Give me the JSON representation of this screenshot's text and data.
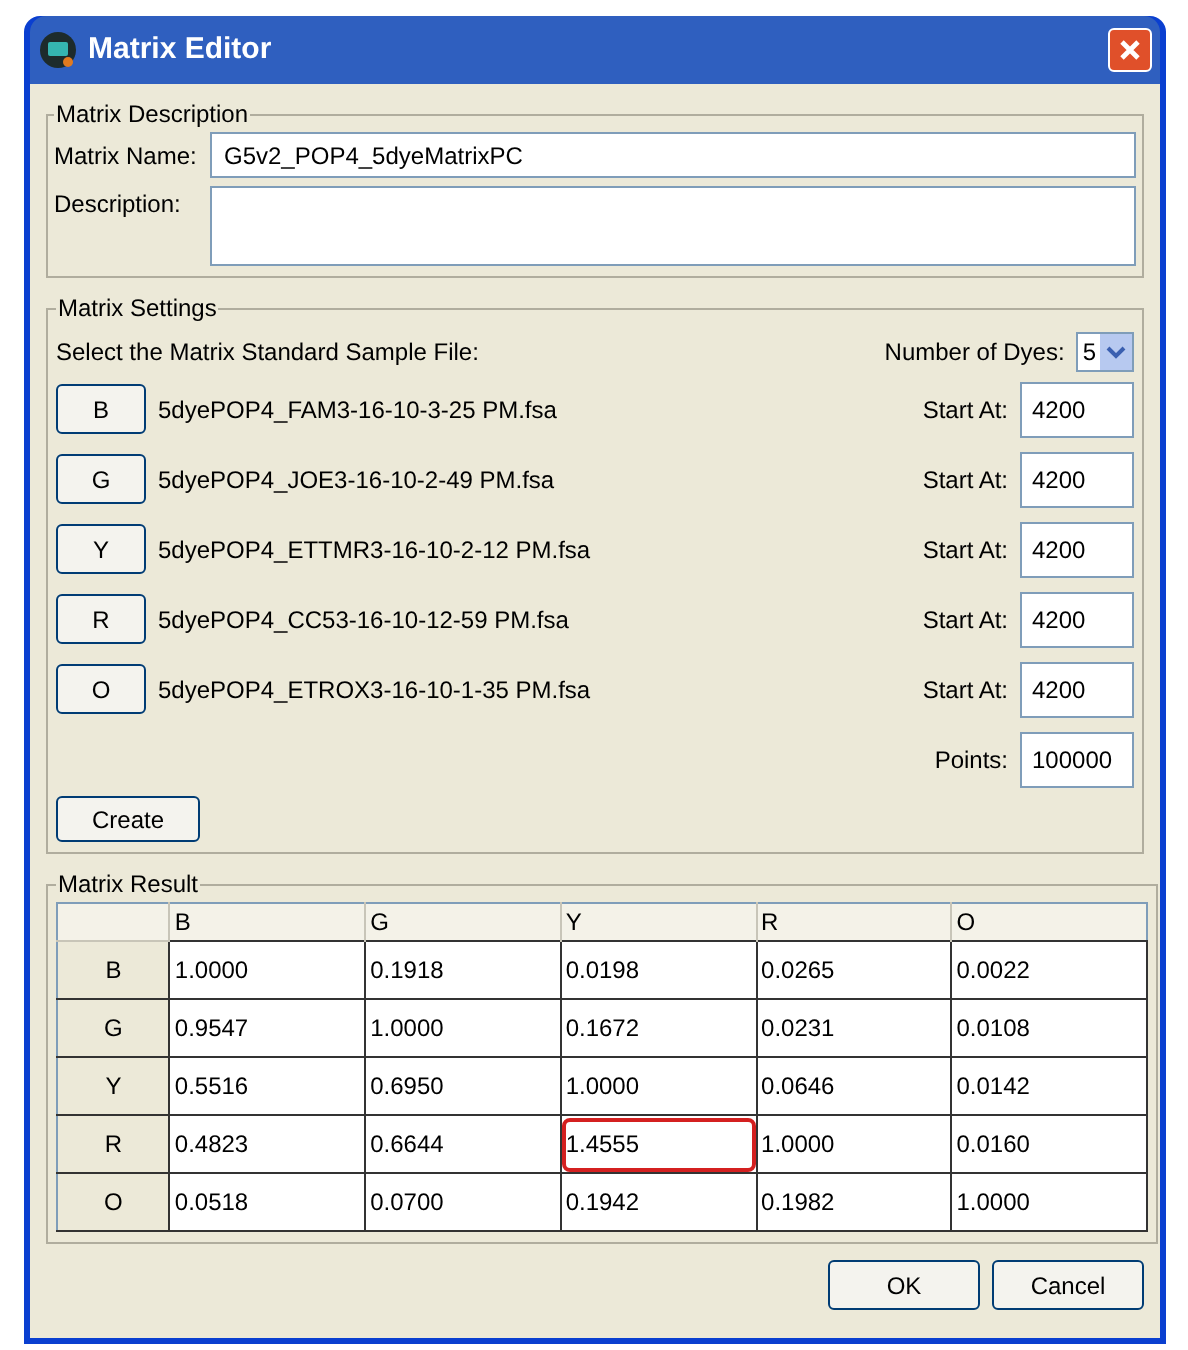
{
  "window": {
    "title": "Matrix Editor"
  },
  "matrix_description": {
    "legend": "Matrix Description",
    "name_label": "Matrix Name:",
    "name_value": "G5v2_POP4_5dyeMatrixPC",
    "description_label": "Description:"
  },
  "matrix_settings": {
    "legend": "Matrix Settings",
    "select_label": "Select the Matrix Standard Sample File:",
    "dyes_label": "Number of Dyes:",
    "dyes_value": "5",
    "files": [
      {
        "dye": "B",
        "file": "5dyePOP4_FAM3-16-10-3-25 PM.fsa",
        "start_label": "Start At:",
        "start_value": "4200"
      },
      {
        "dye": "G",
        "file": "5dyePOP4_JOE3-16-10-2-49 PM.fsa",
        "start_label": "Start At:",
        "start_value": "4200"
      },
      {
        "dye": "Y",
        "file": "5dyePOP4_ETTMR3-16-10-2-12 PM.fsa",
        "start_label": "Start At:",
        "start_value": "4200"
      },
      {
        "dye": "R",
        "file": "5dyePOP4_CC53-16-10-12-59 PM.fsa",
        "start_label": "Start At:",
        "start_value": "4200"
      },
      {
        "dye": "O",
        "file": "5dyePOP4_ETROX3-16-10-1-35 PM.fsa",
        "start_label": "Start At:",
        "start_value": "4200"
      }
    ],
    "points_label": "Points:",
    "points_value": "100000",
    "create_button": "Create"
  },
  "matrix_result": {
    "legend": "Matrix Result",
    "columns": [
      "B",
      "G",
      "Y",
      "R",
      "O"
    ],
    "rows": [
      {
        "header": "B",
        "cells": [
          {
            "value": "1.0000",
            "highlighted": false
          },
          {
            "value": "0.1918",
            "highlighted": false
          },
          {
            "value": "0.0198",
            "highlighted": false
          },
          {
            "value": "0.0265",
            "highlighted": false
          },
          {
            "value": "0.0022",
            "highlighted": false
          }
        ]
      },
      {
        "header": "G",
        "cells": [
          {
            "value": "0.9547",
            "highlighted": false
          },
          {
            "value": "1.0000",
            "highlighted": false
          },
          {
            "value": "0.1672",
            "highlighted": false
          },
          {
            "value": "0.0231",
            "highlighted": false
          },
          {
            "value": "0.0108",
            "highlighted": false
          }
        ]
      },
      {
        "header": "Y",
        "cells": [
          {
            "value": "0.5516",
            "highlighted": false
          },
          {
            "value": "0.6950",
            "highlighted": false
          },
          {
            "value": "1.0000",
            "highlighted": false
          },
          {
            "value": "0.0646",
            "highlighted": false
          },
          {
            "value": "0.0142",
            "highlighted": false
          }
        ]
      },
      {
        "header": "R",
        "cells": [
          {
            "value": "0.4823",
            "highlighted": false
          },
          {
            "value": "0.6644",
            "highlighted": false
          },
          {
            "value": "1.4555",
            "highlighted": true
          },
          {
            "value": "1.0000",
            "highlighted": false
          },
          {
            "value": "0.0160",
            "highlighted": false
          }
        ]
      },
      {
        "header": "O",
        "cells": [
          {
            "value": "0.0518",
            "highlighted": false
          },
          {
            "value": "0.0700",
            "highlighted": false
          },
          {
            "value": "0.1942",
            "highlighted": false
          },
          {
            "value": "0.1982",
            "highlighted": false
          },
          {
            "value": "1.0000",
            "highlighted": false
          }
        ]
      }
    ]
  },
  "buttons": [
    "OK",
    "Cancel"
  ]
}
